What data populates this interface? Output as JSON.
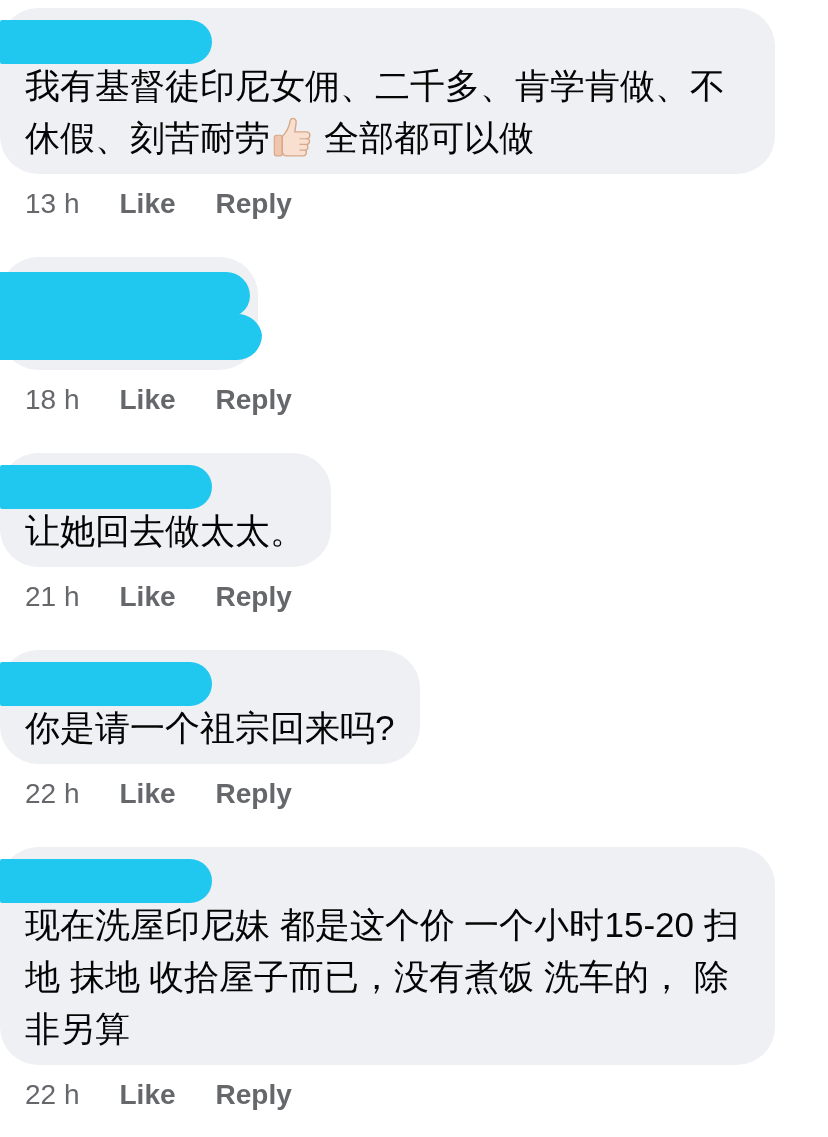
{
  "comments": [
    {
      "name_redacted": true,
      "text_redacted": false,
      "body": [
        {
          "kind": "text",
          "text": "我有基督徒印尼女佣、二千多、肯学肯做、不休假、刻苦耐劳"
        },
        {
          "kind": "emoji"
        },
        {
          "kind": "text",
          "text": "全部都可以做"
        }
      ],
      "time": "13 h",
      "actions": [
        "Like",
        "Reply"
      ]
    },
    {
      "name_redacted": true,
      "text_redacted": true,
      "time": "18 h",
      "actions": [
        "Like",
        "Reply"
      ]
    },
    {
      "name_redacted": true,
      "text_redacted": false,
      "body": [
        {
          "kind": "text",
          "text": "让她回去做太太。"
        }
      ],
      "time": "21 h",
      "actions": [
        "Like",
        "Reply"
      ]
    },
    {
      "name_redacted": true,
      "text_redacted": false,
      "body": [
        {
          "kind": "text",
          "text": "你是请一个祖宗回来吗?"
        }
      ],
      "time": "22 h",
      "actions": [
        "Like",
        "Reply"
      ]
    },
    {
      "name_redacted": true,
      "text_redacted": false,
      "body": [
        {
          "kind": "text",
          "text": "现在洗屋印尼妹 都是这个价 一个小时15-20 扫地 抹地 收拾屋子而已，没有煮饭 洗车的， 除非另算"
        }
      ],
      "time": "22 h",
      "actions": [
        "Like",
        "Reply"
      ]
    }
  ]
}
